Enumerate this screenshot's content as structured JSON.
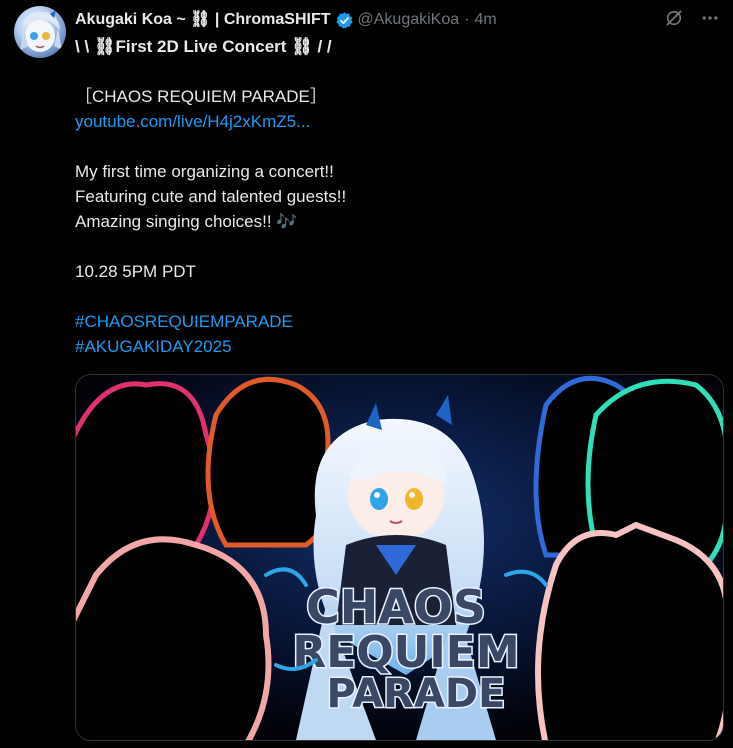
{
  "author": {
    "display_name": "Akugaki Koa ~ ⛓ | ChromaSHIFT",
    "handle": "@AkugakiKoa",
    "separator": "·",
    "time": "4m"
  },
  "tweet": {
    "lines": [
      "\\ \\ ⛓First 2D Live Concert ⛓ / /",
      "",
      "［CHAOS REQUIEM PARADE］",
      "youtube.com/live/H4j2xKmZ5...",
      "",
      "My first time organizing a concert!!",
      "Featuring cute and talented guests!!",
      "Amazing singing choices!! 🎶",
      "",
      "10.28 5PM PDT",
      "",
      "#CHAOSREQUIEMPARADE",
      "#AKUGAKIDAY2025"
    ]
  },
  "media": {
    "logo_lines": [
      "CHAOS",
      "REQUIEM",
      "PARADE"
    ]
  },
  "icons": {
    "verified": "verified-badge-icon",
    "grok": "grok-icon",
    "more": "more-icon"
  },
  "colors": {
    "background": "#000000",
    "text": "#e7e9ea",
    "muted": "#71767b",
    "link": "#1d9bf0",
    "verified": "#1d9bf0"
  }
}
